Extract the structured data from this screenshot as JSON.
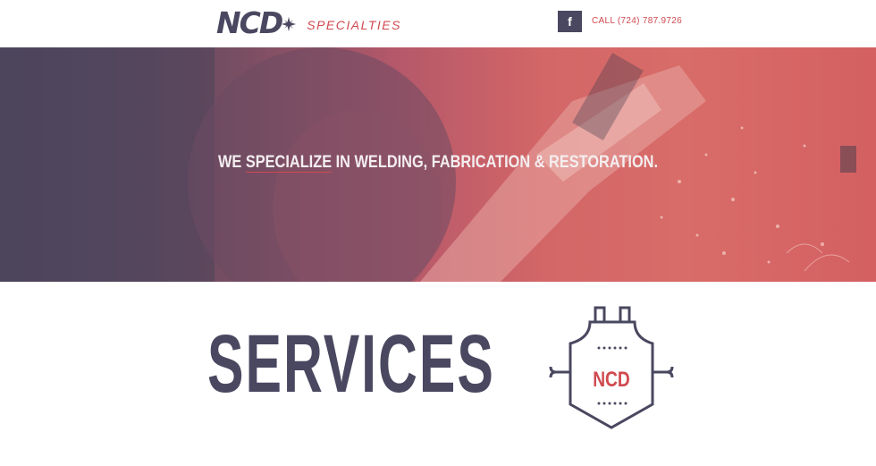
{
  "header": {
    "logo_mark": "NCD",
    "logo_sub": "SPECIALTIES",
    "facebook_glyph": "f",
    "call_text": "CALL (724) 787.9726"
  },
  "hero": {
    "pre": "WE ",
    "underlined": "SPECIALIZE",
    "post": " IN WELDING, FABRICATION & RESTORATION."
  },
  "services": {
    "title": "SERVICES",
    "badge_text": "NCD"
  },
  "colors": {
    "brand_dark": "#4a4860",
    "brand_red": "#d04a50"
  },
  "icons": [
    "star-icon",
    "facebook-icon",
    "apron-icon"
  ]
}
